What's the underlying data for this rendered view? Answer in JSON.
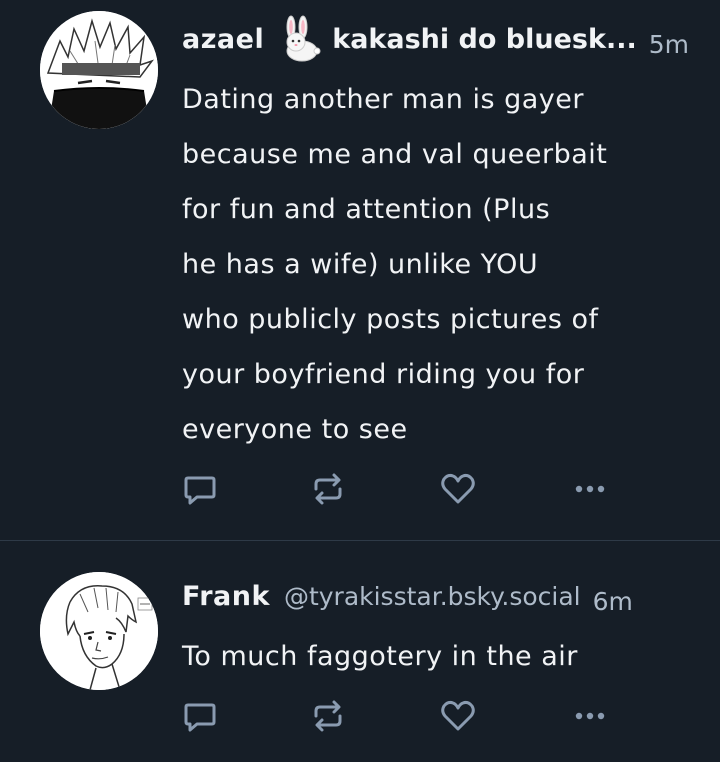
{
  "posts": [
    {
      "display_name": "azael",
      "emoji": "rabbit",
      "title_name": "kakashi do bluesk...",
      "time": "5m",
      "lines": [
        "Dating another man is gayer",
        "because me and val queerbait",
        "for fun and attention (Plus",
        "he has a wife) unlike YOU",
        "who publicly posts pictures of",
        "your boyfriend riding you for",
        "everyone to see"
      ],
      "actions": [
        "reply-icon",
        "repost-icon",
        "like-icon",
        "more-icon"
      ]
    },
    {
      "display_name": "Frank",
      "handle": "@tyrakisstar.bsky.social",
      "time": "6m",
      "lines": [
        "To much faggotery in the air"
      ],
      "actions": [
        "reply-icon",
        "repost-icon",
        "like-icon",
        "more-icon"
      ]
    }
  ],
  "colors": {
    "background": "#161e27",
    "text": "#f1f3f5",
    "muted": "#aebbc9",
    "icon": "#8a9bb0",
    "divider": "#2e3a47"
  }
}
